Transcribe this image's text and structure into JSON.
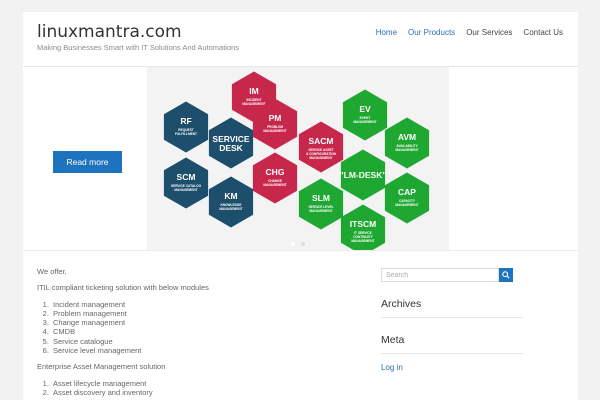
{
  "header": {
    "site_title": "linuxmantra.com",
    "tagline": "Making Businesses Smart with IT Solutions And Automations"
  },
  "nav": {
    "items": [
      "Home",
      "Our Products",
      "Our Services",
      "Contact Us"
    ],
    "active": "Home"
  },
  "hero": {
    "read_more": "Read more",
    "hexagons": [
      {
        "code": "IM",
        "desc": [
          "INCIDENT",
          "MANAGEMENT"
        ],
        "color": "#c8274c"
      },
      {
        "code": "RF",
        "desc": [
          "REQUEST",
          "FULFILLMENT"
        ],
        "color": "#1d4e6b"
      },
      {
        "code": "PM",
        "desc": [
          "PROBLEM",
          "MANAGEMENT"
        ],
        "color": "#c8274c"
      },
      {
        "code": "SERVICE DESK",
        "desc": [],
        "color": "#1d4e6b"
      },
      {
        "code": "SCM",
        "desc": [
          "SERVICE CATALOG",
          "MANAGEMENT"
        ],
        "color": "#1d4e6b"
      },
      {
        "code": "CHG",
        "desc": [
          "CHANGE",
          "MANAGEMENT"
        ],
        "color": "#c8274c"
      },
      {
        "code": "KM",
        "desc": [
          "KNOWLEDGE",
          "MANAGEMENT"
        ],
        "color": "#1d4e6b"
      },
      {
        "code": "SACM",
        "desc": [
          "SERVICE ASSET",
          "& CONFIGURATION",
          "MANAGEMENT"
        ],
        "color": "#c8274c"
      },
      {
        "code": "EV",
        "desc": [
          "EVENT",
          "MANAGEMENT"
        ],
        "color": "#1ea832"
      },
      {
        "code": "AVM",
        "desc": [
          "AVAILABILITY",
          "MANAGEMENT"
        ],
        "color": "#1ea832"
      },
      {
        "code": "\"LM-DESK\"",
        "desc": [],
        "color": "#1ea832"
      },
      {
        "code": "SLM",
        "desc": [
          "SERVICE LEVEL",
          "MANAGEMENT"
        ],
        "color": "#1ea832"
      },
      {
        "code": "CAP",
        "desc": [
          "CAPACITY",
          "MANAGEMENT"
        ],
        "color": "#1ea832"
      },
      {
        "code": "ITSCM",
        "desc": [
          "IT SERVICE",
          "CONTINUITY",
          "MANAGEMENT"
        ],
        "color": "#1ea832"
      }
    ]
  },
  "content": {
    "intro": "We offer,",
    "section1_title": "ITIL compliant ticketing solution with below modules",
    "section1_items": [
      "Incident management",
      "Problem management",
      "Change management",
      "CMDB",
      "Service catalogue",
      "Service level management"
    ],
    "section2_title": "Enterprise Asset Management solution",
    "section2_items": [
      "Asset lifecycle management",
      "Asset discovery and inventory"
    ]
  },
  "sidebar": {
    "search_placeholder": "Search",
    "archives_title": "Archives",
    "meta_title": "Meta",
    "meta_links": [
      "Log in"
    ]
  },
  "colors": {
    "accent": "#1e73be",
    "link": "#2a6fb4",
    "hex_red": "#c8274c",
    "hex_navy": "#1d4e6b",
    "hex_green": "#1ea832"
  }
}
